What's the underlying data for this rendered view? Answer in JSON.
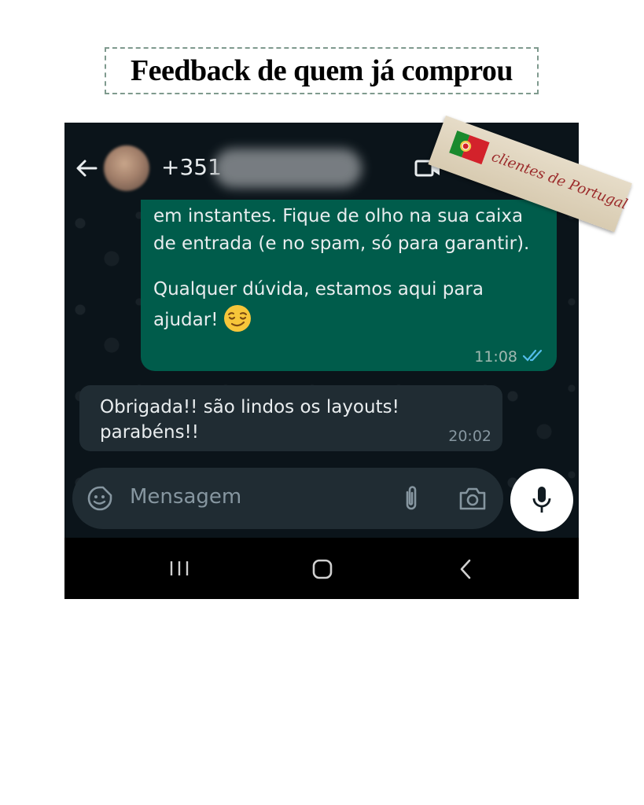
{
  "headline": "Feedback de quem já comprou",
  "sticker": {
    "label": "clientes de Portugal",
    "flag": "portugal-flag"
  },
  "header": {
    "contact_prefix": "+351",
    "icons": [
      "back-arrow-icon",
      "video-call-icon"
    ]
  },
  "messages": [
    {
      "direction": "outgoing",
      "paragraphs": [
        "em instantes. Fique de olho na sua caixa de entrada (e no spam, só para garantir).",
        "Qualquer dúvida, estamos aqui para ajudar!"
      ],
      "emoji": "winking-face",
      "time": "11:08",
      "status": "read"
    },
    {
      "direction": "incoming",
      "text": "Obrigada!! são lindos os layouts! parabéns!!",
      "time": "20:02"
    }
  ],
  "composer": {
    "placeholder": "Mensagem",
    "icons": [
      "sticker-icon",
      "attach-icon",
      "camera-icon",
      "mic-icon"
    ]
  },
  "navbar": {
    "icons": [
      "recent-apps-icon",
      "home-icon",
      "back-icon"
    ]
  },
  "colors": {
    "chat_bg": "#0b141a",
    "outgoing_bubble": "#005c4b",
    "incoming_bubble": "#202c33",
    "read_ticks": "#53bdeb",
    "tape_text": "#9b2a2a"
  }
}
